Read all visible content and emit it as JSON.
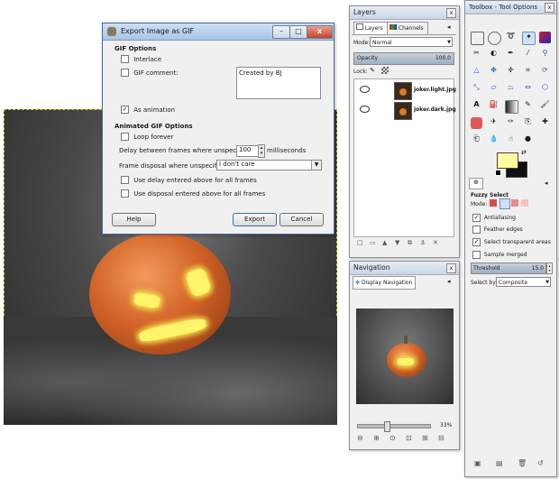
{
  "export_dialog": {
    "title": "Export Image as GIF",
    "section_gif": "GIF Options",
    "interlace_label": "Interlace",
    "gif_comment_label": "GIF comment:",
    "comment_value": "Created by BJ",
    "as_animation_label": "As animation",
    "as_animation_check": "✓",
    "section_animated": "Animated GIF Options",
    "loop_forever_label": "Loop forever",
    "delay_label": "Delay between frames where unspecified:",
    "delay_value": "100",
    "delay_unit": "milliseconds",
    "disposal_label": "Frame disposal where unspecified:",
    "disposal_value": "I don't care",
    "use_delay_label": "Use delay entered above for all frames",
    "use_disposal_label": "Use disposal entered above for all frames",
    "help_button": "Help",
    "export_button": "Export",
    "cancel_button": "Cancel"
  },
  "layers_panel": {
    "title": "Layers",
    "tab_layers": "Layers",
    "tab_channels": "Channels",
    "mode_label": "Mode:",
    "mode_value": "Normal",
    "opacity_label": "Opacity",
    "opacity_value": "100.0",
    "lock_label": "Lock:",
    "layers": [
      {
        "name": "joker.light.jpg"
      },
      {
        "name": "joker.dark.jpg"
      }
    ]
  },
  "navigation_panel": {
    "title": "Navigation",
    "tab_label": "Display Navigation",
    "zoom_value": "33%"
  },
  "toolbox": {
    "title": "Toolbox - Tool Options",
    "tool_name": "Fuzzy Select",
    "mode_label": "Mode:",
    "antialiasing_label": "Antialiasing",
    "feather_label": "Feather edges",
    "select_transparent_label": "Select transparent areas",
    "sample_merged_label": "Sample merged",
    "threshold_label": "Threshold",
    "threshold_value": "15.0",
    "select_by_label": "Select by:",
    "select_by_value": "Composite",
    "check_mark": "✓"
  },
  "colors": {
    "fg": "#fdfda0",
    "bg": "#111111",
    "dialog_accent": "#3a6ea5"
  }
}
